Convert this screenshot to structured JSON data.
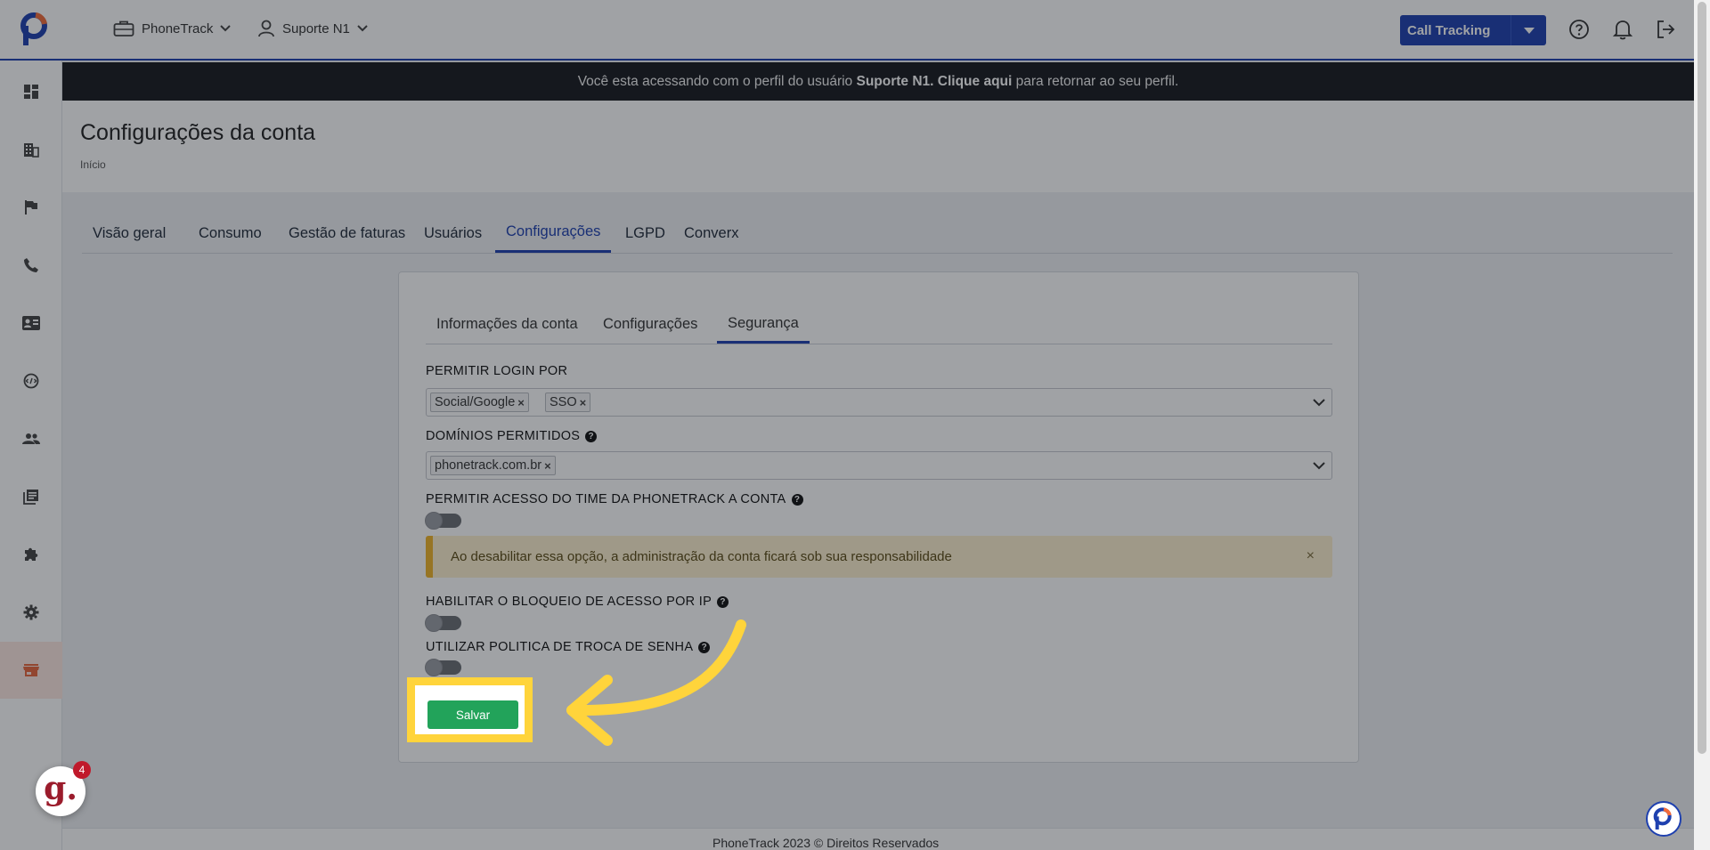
{
  "header": {
    "company_label": "PhoneTrack",
    "user_label": "Suporte N1",
    "product_select": "Call Tracking"
  },
  "banner": {
    "text_before": "Você esta acessando com o perfil do usuário ",
    "user_bold": "Suporte N1. Clique aqui",
    "text_after": " para retornar ao seu perfil."
  },
  "page": {
    "title": "Configurações da conta",
    "breadcrumb": "Início"
  },
  "main_tabs": [
    {
      "label": "Visão geral"
    },
    {
      "label": "Consumo"
    },
    {
      "label": "Gestão de faturas"
    },
    {
      "label": "Usuários"
    },
    {
      "label": "Configurações",
      "active": true
    },
    {
      "label": "LGPD"
    },
    {
      "label": "Converx"
    }
  ],
  "sub_tabs": [
    {
      "label": "Informações da conta"
    },
    {
      "label": "Configurações"
    },
    {
      "label": "Segurança",
      "active": true
    }
  ],
  "security": {
    "login_label": "PERMITIR LOGIN POR",
    "login_values": [
      "Social/Google",
      "SSO"
    ],
    "domains_label": "DOMÍNIOS PERMITIDOS",
    "domains_values": [
      "phonetrack.com.br"
    ],
    "team_access_label": "PERMITIR ACESSO DO TIME DA PHONETRACK A CONTA",
    "team_access_enabled": false,
    "alert_text": "Ao desabilitar essa opção, a administração da conta ficará sob sua responsabilidade",
    "ip_block_label": "HABILITAR O BLOQUEIO DE ACESSO POR IP",
    "ip_block_enabled": false,
    "password_policy_label": "UTILIZAR POLITICA DE TROCA DE SENHA",
    "password_policy_enabled": false,
    "save_label": "Salvar",
    "help_glyph": "?",
    "remove_glyph": "×",
    "close_glyph": "×"
  },
  "footer": {
    "text": "PhoneTrack 2023 © Direitos Reservados"
  },
  "widgets": {
    "chat_letter": "g.",
    "chat_badge": "4"
  },
  "colors": {
    "primary": "#1e40af",
    "success": "#22a35a",
    "highlight": "#ffd43b",
    "alert_bg": "#fdf1cf",
    "alert_border": "#f0b429",
    "banner_bg": "#181a1f"
  },
  "icons": {
    "sidebar": [
      "dashboard-icon",
      "building-icon",
      "flag-icon",
      "phone-icon",
      "contact-card-icon",
      "api-icon",
      "people-icon",
      "library-icon",
      "puzzle-icon",
      "gear-icon",
      "store-icon"
    ],
    "top": [
      "briefcase-icon",
      "user-icon",
      "help-circle-icon",
      "bell-icon",
      "logout-icon"
    ]
  }
}
